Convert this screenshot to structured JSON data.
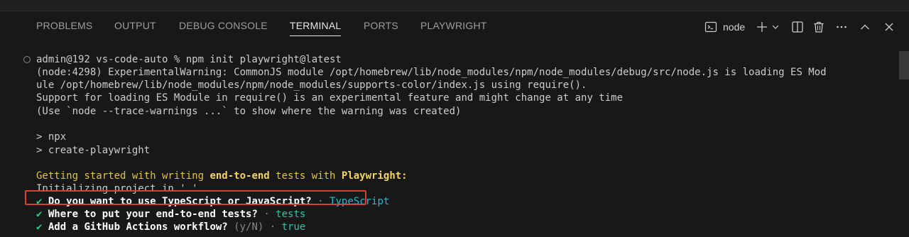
{
  "tabs": [
    {
      "label": "PROBLEMS"
    },
    {
      "label": "OUTPUT"
    },
    {
      "label": "DEBUG CONSOLE"
    },
    {
      "label": "TERMINAL"
    },
    {
      "label": "PORTS"
    },
    {
      "label": "PLAYWRIGHT"
    }
  ],
  "active_tab": "TERMINAL",
  "actions": {
    "terminal_name": "node",
    "icons": [
      "terminal-icon",
      "plus-icon",
      "chevron-down-icon",
      "split-icon",
      "trash-icon",
      "more-icon",
      "chevron-up-icon",
      "close-icon"
    ]
  },
  "terminal": {
    "prompt": "admin@192 vs-code-auto % npm init playwright@latest",
    "warning_1": "(node:4298) ExperimentalWarning: CommonJS module /opt/homebrew/lib/node_modules/npm/node_modules/debug/src/node.js is loading ES Mod",
    "warning_2": "ule /opt/homebrew/lib/node_modules/npm/node_modules/supports-color/index.js using require().",
    "warning_3": "Support for loading ES Module in require() is an experimental feature and might change at any time",
    "warning_4": "(Use `node --trace-warnings ...` to show where the warning was created)",
    "npx_1": "> npx",
    "npx_2": "> create-playwright",
    "getting_started": {
      "part1": "Getting started with writing ",
      "part2": "end-to-end",
      "part3": " tests with ",
      "part4": "Playwright:"
    },
    "initializing": "Initializing project in '.'",
    "questions": [
      {
        "check": "✔",
        "question": "Do you want to use TypeScript or JavaScript?",
        "sep": " · ",
        "answer": "TypeScript"
      },
      {
        "check": "✔",
        "question": "Where to put your end-to-end tests?",
        "sep": " · ",
        "answer": "tests"
      },
      {
        "check": "✔",
        "question": "Add a GitHub Actions workflow?",
        "hint": " (y/N)",
        "sep": " · ",
        "answer": "true"
      }
    ]
  },
  "colors": {
    "highlight_border": "#d9402e",
    "answer_blue": "#29b8db",
    "answer_teal": "#2fc1a7",
    "check_green": "#23d18b"
  }
}
